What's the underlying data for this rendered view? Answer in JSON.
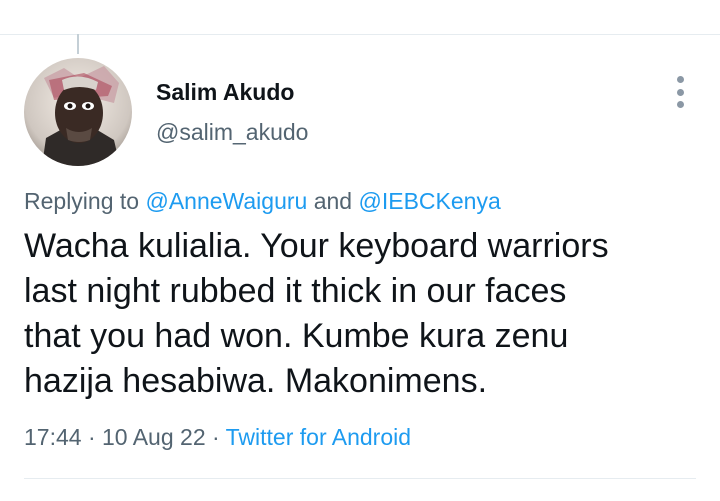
{
  "tweet": {
    "author": {
      "display_name": "Salim Akudo",
      "handle": "@salim_akudo"
    },
    "replying": {
      "prefix": "Replying to",
      "mentions": [
        "@AnneWaiguru",
        "@IEBCKenya"
      ],
      "joiner": "and"
    },
    "lines": [
      "Wacha kulialia. Your keyboard warriors",
      "last night rubbed it thick in our faces",
      "that you had won. Kumbe kura zenu",
      "hazija hesabiwa. Makonimens."
    ],
    "meta": {
      "time": "17:44",
      "sep": " · ",
      "date": "10 Aug 22",
      "source": "Twitter for Android"
    }
  },
  "colors": {
    "link": "#1d9bf0",
    "secondary_text": "#536471",
    "primary_text": "#0f1419",
    "divider": "#e6ecf0"
  },
  "icons": {
    "more": "vertical-ellipsis"
  }
}
